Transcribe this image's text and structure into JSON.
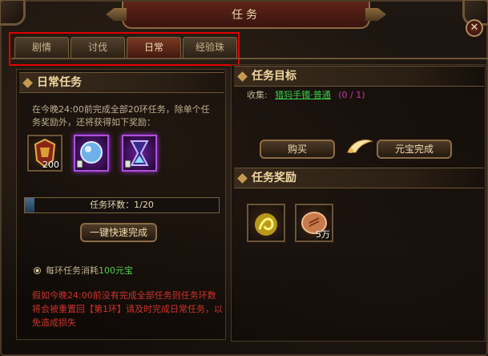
{
  "window": {
    "title": "任务"
  },
  "tabs": [
    {
      "label": "剧情",
      "active": false
    },
    {
      "label": "讨伐",
      "active": false
    },
    {
      "label": "日常",
      "active": true
    },
    {
      "label": "经验珠",
      "active": false
    }
  ],
  "left": {
    "header": "日常任务",
    "description": "在今晚24:00前完成全部20环任务，除单个任务奖励外，还将获得如下奖励：",
    "rewards": [
      {
        "icon": "armor-icon",
        "count": "200"
      },
      {
        "icon": "crystal-orb-icon",
        "count": ""
      },
      {
        "icon": "hourglass-icon",
        "count": ""
      }
    ],
    "progress": {
      "label": "任务环数：1/20",
      "value": 0.05
    },
    "quick_complete_label": "一键快速完成",
    "cost_prefix": "每环任务消耗",
    "cost_value": "100元宝",
    "warning": "假如今晚24:00前没有完成全部任务则任务环数将会被重置回【第1环】请及时完成日常任务，以免造成损失"
  },
  "right": {
    "goal_header": "任务目标",
    "collect_label": "收集:",
    "collect_item": "猎犸手镯·普通",
    "collect_count": "(0 / 1)",
    "buy_label": "购买",
    "gold_complete_label": "元宝完成",
    "reward_header": "任务奖励",
    "rewards": [
      {
        "icon": "experience-orb-icon",
        "count": ""
      },
      {
        "icon": "coin-icon",
        "count": "5万"
      }
    ]
  },
  "colors": {
    "accent": "#f0d7a2",
    "link_green": "#39d04a",
    "warning_red": "#d0322a",
    "highlight_red": "#e00000"
  }
}
